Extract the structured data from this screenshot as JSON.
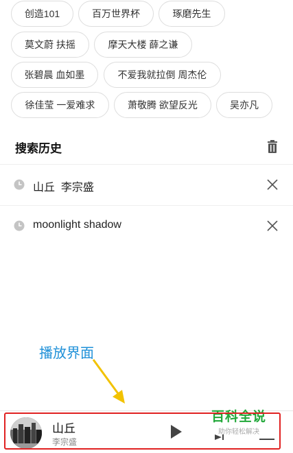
{
  "hot_tags": [
    [
      "创造101",
      "百万世界杯",
      "琢磨先生"
    ],
    [
      "莫文蔚 扶摇",
      "摩天大楼 薛之谦"
    ],
    [
      "张碧晨 血如墨",
      "不爱我就拉倒 周杰伦"
    ],
    [
      "徐佳莹 一爱难求",
      "萧敬腾 欲望反光",
      "吴亦凡"
    ]
  ],
  "history": {
    "title": "搜索历史",
    "items": [
      {
        "text": "山丘  李宗盛"
      },
      {
        "text": "moonlight shadow"
      }
    ]
  },
  "annotation": {
    "label": "播放界面",
    "color": "#1e90d8",
    "arrow_color": "#f2c200",
    "frame_color": "#e02020"
  },
  "player": {
    "title": "山丘",
    "artist": "李宗盛"
  },
  "watermark": {
    "main": "百科全说",
    "sub": "助你轻松解决",
    "color": "#22a83a"
  }
}
